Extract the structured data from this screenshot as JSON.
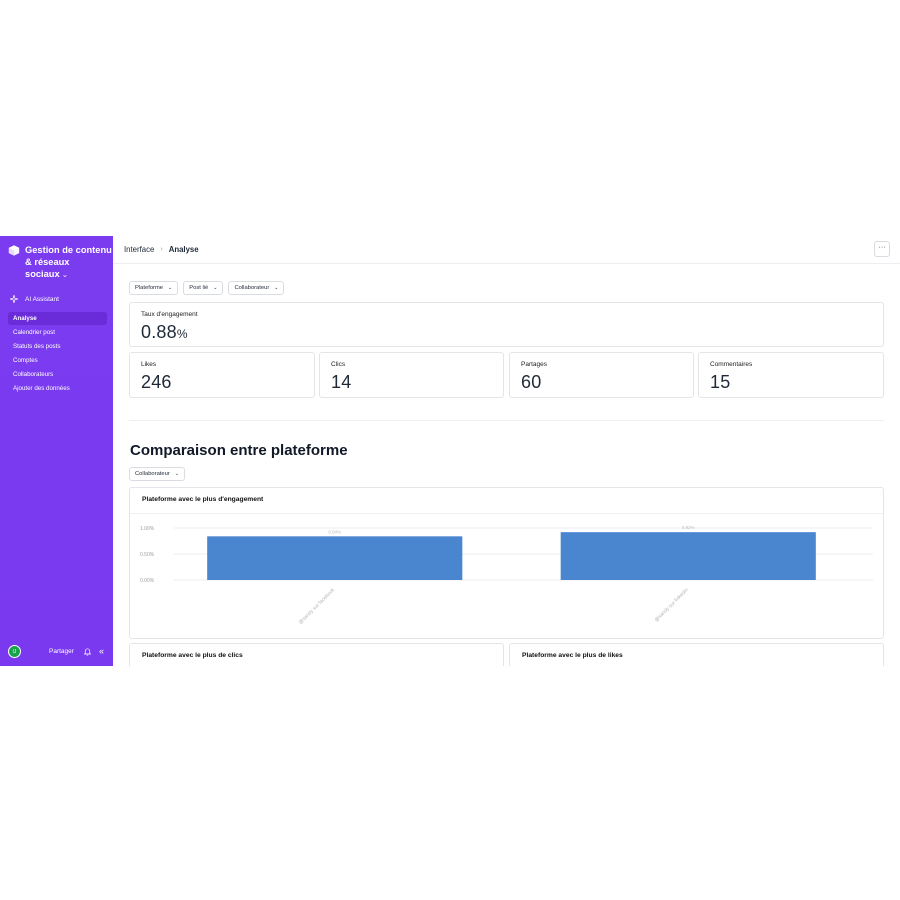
{
  "sidebar": {
    "brand_line1": "Gestion de contenu",
    "brand_line2": "& réseaux sociaux",
    "ai_label": "AI Assistant",
    "items": [
      {
        "label": "Analyse"
      },
      {
        "label": "Calendrier post"
      },
      {
        "label": "Statuts des posts"
      },
      {
        "label": "Comptes"
      },
      {
        "label": "Collaborateurs"
      },
      {
        "label": "Ajouter des données"
      }
    ],
    "avatar_initials": "IJ",
    "share_label": "Partager"
  },
  "breadcrumb": {
    "parent": "Interface",
    "current": "Analyse"
  },
  "more_label": "···",
  "filters": [
    {
      "label": "Plateforme"
    },
    {
      "label": "Post lié"
    },
    {
      "label": "Collaborateur"
    }
  ],
  "kpis": {
    "engagement": {
      "label": "Taux d'engagement",
      "value": "0.88",
      "unit": "%"
    },
    "likes": {
      "label": "Likes",
      "value": "246"
    },
    "clics": {
      "label": "Clics",
      "value": "14"
    },
    "partages": {
      "label": "Partages",
      "value": "60"
    },
    "commentaires": {
      "label": "Commentaires",
      "value": "15"
    }
  },
  "comparison": {
    "title": "Comparaison entre plateforme",
    "filter_label": "Collaborateur",
    "card_engagement_title": "Plateforme avec le plus d'engagement",
    "card_clics_title": "Plateforme avec le plus de clics",
    "card_likes_title": "Plateforme avec le plus de likes"
  },
  "colors": {
    "sidebar": "#7b3cf0",
    "bar": "#4a86cf",
    "avatar": "#17a34a"
  },
  "chart_data": {
    "type": "bar",
    "title": "Plateforme avec le plus d'engagement",
    "categories": [
      "@sandy sur facebook",
      "@sandy sur linkedin"
    ],
    "values": [
      0.84,
      0.92
    ],
    "value_labels": [
      "0.84%",
      "0.92%"
    ],
    "yticks": [
      "1.00%",
      "0.50%",
      "0.00%"
    ],
    "ylim": [
      0,
      1
    ],
    "grid": true
  }
}
